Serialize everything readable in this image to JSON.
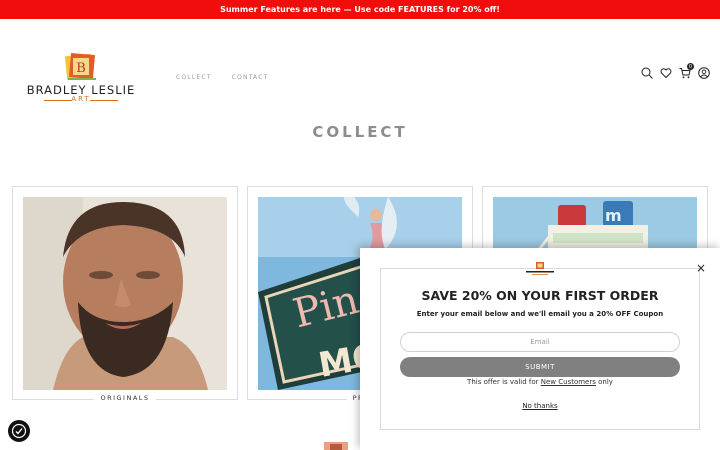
{
  "promo": {
    "text": "Summer Features are here — Use code FEATURES for 20% off!"
  },
  "logo": {
    "name": "BRADLEY LESLIE",
    "sub": "ART"
  },
  "nav": {
    "items": [
      {
        "label": "COLLECT"
      },
      {
        "label": "CONTACT"
      }
    ]
  },
  "header_icons": [
    "search-icon",
    "heart-icon",
    "cart-icon",
    "account-icon"
  ],
  "cart": {
    "count": "0"
  },
  "page": {
    "title": "COLLECT"
  },
  "cards": [
    {
      "label": "ORIGINALS"
    },
    {
      "label": "PRI"
    },
    {
      "label": ""
    }
  ],
  "modal": {
    "heading": "SAVE 20% ON YOUR FIRST ORDER",
    "sub": "Enter your email below and we'll email you a 20% OFF Coupon",
    "email_placeholder": "Email",
    "submit_label": "SUBMIT",
    "note_prefix": "This offer is valid for ",
    "note_link": "New Customers",
    "note_suffix": " only",
    "no_thanks": "No thanks",
    "close": "×"
  },
  "colors": {
    "promo_bg": "#f20d0d",
    "accent": "#d96f1c",
    "submit_bg": "#808080"
  }
}
